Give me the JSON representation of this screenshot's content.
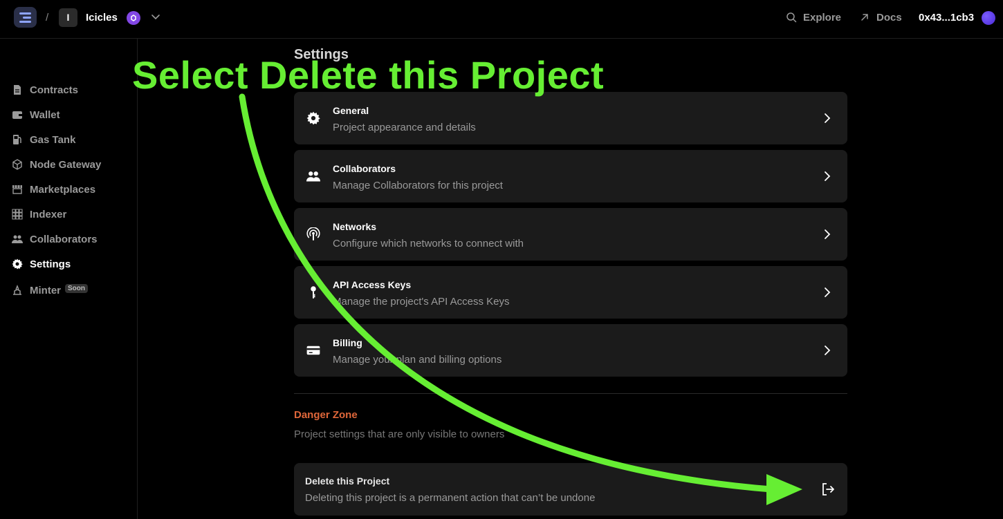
{
  "topbar": {
    "separator": "/",
    "project_initial": "I",
    "project_name": "Icicles",
    "explore_label": "Explore",
    "docs_label": "Docs",
    "wallet_address": "0x43...1cb3"
  },
  "sidebar": {
    "items": [
      {
        "label": "Contracts",
        "icon": "contracts-icon"
      },
      {
        "label": "Wallet",
        "icon": "wallet-icon"
      },
      {
        "label": "Gas Tank",
        "icon": "gas-tank-icon"
      },
      {
        "label": "Node Gateway",
        "icon": "cube-icon"
      },
      {
        "label": "Marketplaces",
        "icon": "storefront-icon"
      },
      {
        "label": "Indexer",
        "icon": "grid-icon"
      },
      {
        "label": "Collaborators",
        "icon": "people-icon"
      },
      {
        "label": "Settings",
        "icon": "gear-icon",
        "active": true
      },
      {
        "label": "Minter",
        "icon": "minter-icon",
        "badge": "Soon"
      }
    ]
  },
  "main": {
    "title": "Settings",
    "cards": [
      {
        "title": "General",
        "description": "Project appearance and details",
        "icon": "gear-icon"
      },
      {
        "title": "Collaborators",
        "description": "Manage Collaborators for this project",
        "icon": "people-icon"
      },
      {
        "title": "Networks",
        "description": "Configure which networks to connect with",
        "icon": "antenna-icon"
      },
      {
        "title": "API Access Keys",
        "description": "Manage the project's API Access Keys",
        "icon": "key-icon"
      },
      {
        "title": "Billing",
        "description": "Manage your plan and billing options",
        "icon": "credit-card-icon"
      }
    ],
    "danger_zone": {
      "title": "Danger Zone",
      "description": "Project settings that are only visible to owners",
      "delete": {
        "title": "Delete this Project",
        "description": "Deleting this project is a permanent action that can’t be undone",
        "icon": "exit-icon"
      }
    }
  },
  "annotation": {
    "text": "Select Delete this Project",
    "color": "#66ee33"
  },
  "colors": {
    "background": "#000000",
    "card": "#1b1b1b",
    "danger": "#e0673a",
    "network_badge": "#8247e5"
  }
}
